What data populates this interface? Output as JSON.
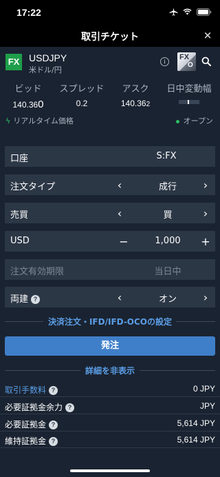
{
  "status_bar": {
    "time": "17:22"
  },
  "header": {
    "title": "取引チケット",
    "close": "×"
  },
  "symbol": {
    "badge": "FX",
    "code": "USDJPY",
    "name": "米ドル/円",
    "info": "i"
  },
  "quotes": {
    "bid_label": "ビッド",
    "bid_main": "140.36",
    "bid_pip": "0",
    "spread_label": "スプレッド",
    "spread_value": "0.2",
    "ask_label": "アスク",
    "ask_main": "140.36",
    "ask_pip": "2",
    "daily_range_label": "日中変動幅"
  },
  "realtime_label": "リアルタイム価格",
  "market_status": "オープン",
  "form": {
    "account_label": "口座",
    "account_value": "S:FX",
    "order_type_label": "注文タイプ",
    "order_type_value": "成行",
    "side_label": "売買",
    "side_value": "買",
    "amount_label": "USD",
    "amount_value": "1,000",
    "minus": "−",
    "plus": "+",
    "expiry_label": "注文有効期限",
    "expiry_value": "当日中",
    "hedge_label": "両建",
    "hedge_value": "オン",
    "prev": "‹",
    "next": "›",
    "help": "?"
  },
  "settlement_link": "決済注文・IFD/IFD-OCOの設定",
  "order_button": "発注",
  "details_toggle": "詳細を非表示",
  "fees": [
    {
      "label": "取引手数料",
      "value": "0 JPY"
    },
    {
      "label": "必要証拠金余力",
      "value": "JPY"
    },
    {
      "label": "必要証拠金",
      "value": "5,614 JPY"
    },
    {
      "label": "維持証拠金",
      "value": "5,614 JPY"
    }
  ]
}
